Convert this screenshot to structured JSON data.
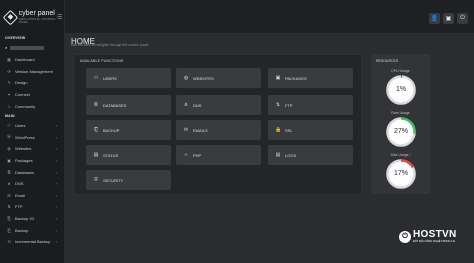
{
  "brand": {
    "name": "cyber panel",
    "subtitle": "WEB HOSTING CONTROL PANEL"
  },
  "sidebar": {
    "overview_label": "OVERVIEW",
    "main_label": "MAIN",
    "overview_items": [
      {
        "label": "Dashboard",
        "icon": "dashboard-icon"
      },
      {
        "label": "Version Management",
        "icon": "version-icon"
      },
      {
        "label": "Design",
        "icon": "design-icon"
      },
      {
        "label": "Connect",
        "icon": "connect-icon"
      },
      {
        "label": "Community",
        "icon": "community-icon"
      }
    ],
    "main_items": [
      {
        "label": "Users",
        "icon": "users-icon"
      },
      {
        "label": "WordPress",
        "icon": "wordpress-icon"
      },
      {
        "label": "Websites",
        "icon": "websites-icon"
      },
      {
        "label": "Packages",
        "icon": "packages-icon"
      },
      {
        "label": "Databases",
        "icon": "databases-icon"
      },
      {
        "label": "DNS",
        "icon": "dns-icon"
      },
      {
        "label": "Email",
        "icon": "email-icon"
      },
      {
        "label": "FTP",
        "icon": "ftp-icon"
      },
      {
        "label": "Backup V2",
        "icon": "backup-v2-icon"
      },
      {
        "label": "Backup",
        "icon": "backup-icon"
      },
      {
        "label": "Incremental Backup",
        "icon": "incremental-backup-icon"
      }
    ]
  },
  "topbar": {
    "actions": [
      "user-icon",
      "save-icon",
      "power-icon"
    ]
  },
  "main": {
    "title": "HOME",
    "subtitle": "Use the tabs to navigate through the control panel.",
    "functions_label": "AVAILABLE FUNCTIONS",
    "tiles": [
      {
        "label": "USERS",
        "icon": "users-icon"
      },
      {
        "label": "WEBSITES",
        "icon": "globe-icon"
      },
      {
        "label": "PACKAGES",
        "icon": "packages-icon"
      },
      {
        "label": "DATABASES",
        "icon": "database-icon"
      },
      {
        "label": "DNS",
        "icon": "dns-icon"
      },
      {
        "label": "FTP",
        "icon": "ftp-icon"
      },
      {
        "label": "BACKUP",
        "icon": "backup-icon"
      },
      {
        "label": "EMAILS",
        "icon": "email-icon"
      },
      {
        "label": "SSL",
        "icon": "lock-icon"
      },
      {
        "label": "STATUS",
        "icon": "status-icon"
      },
      {
        "label": "PHP",
        "icon": "code-icon"
      },
      {
        "label": "LOGS",
        "icon": "logs-icon"
      },
      {
        "label": "SECURITY",
        "icon": "shield-icon"
      }
    ]
  },
  "resources": {
    "label": "RESOURCES",
    "gauges": [
      {
        "label": "CPU Usage",
        "value": "1%",
        "fraction": 0.01,
        "color": "#3a3b40"
      },
      {
        "label": "Ram Usage",
        "value": "27%",
        "fraction": 0.27,
        "color": "#3fbf5c"
      },
      {
        "label": "Disk Usage /",
        "value": "17%",
        "fraction": 0.17,
        "color": "#e04848"
      }
    ]
  },
  "watermark": {
    "name": "HOSTVN",
    "tagline": "ĐỘT ĐỘI CÔNG NGHỆ TRONG LAI"
  }
}
